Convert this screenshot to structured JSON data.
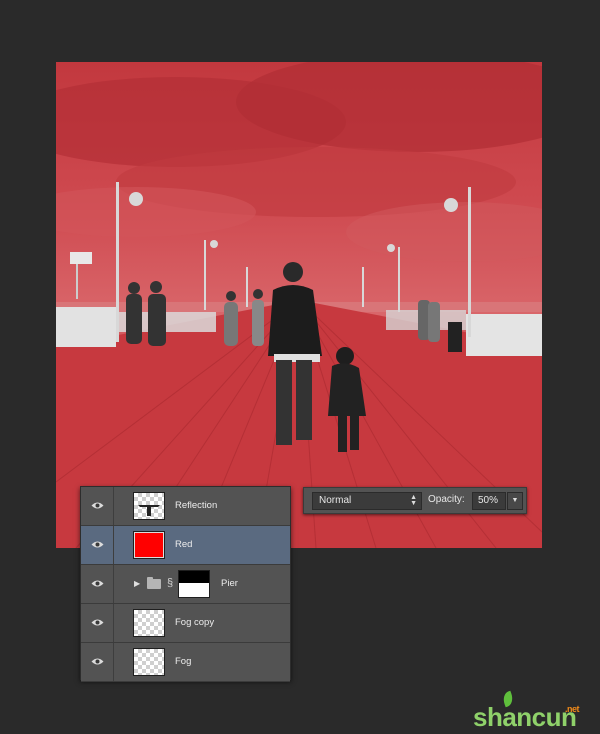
{
  "colors": {
    "background": "#2a2a2a",
    "panel": "#535353",
    "selected_row": "#5a6a80",
    "red_fill": "#ff0000",
    "canvas_tint": "#cf4a50"
  },
  "blend_bar": {
    "mode": "Normal",
    "opacity_label": "Opacity:",
    "opacity_value": "50%"
  },
  "layers": [
    {
      "name": "Reflection",
      "thumb": "checker-reflection",
      "selected": false
    },
    {
      "name": "Red",
      "thumb": "red-fill",
      "selected": true
    },
    {
      "name": "Pier",
      "thumb": "mask",
      "group": true,
      "selected": false
    },
    {
      "name": "Fog copy",
      "thumb": "checker",
      "selected": false
    },
    {
      "name": "Fog",
      "thumb": "checker",
      "selected": false
    }
  ],
  "icons": {
    "visibility": "eye-icon",
    "group": "folder-icon",
    "expand": "disclosure-triangle-icon",
    "link": "chain-link-icon"
  },
  "watermark": {
    "text": "shancun",
    "suffix": ".net"
  }
}
